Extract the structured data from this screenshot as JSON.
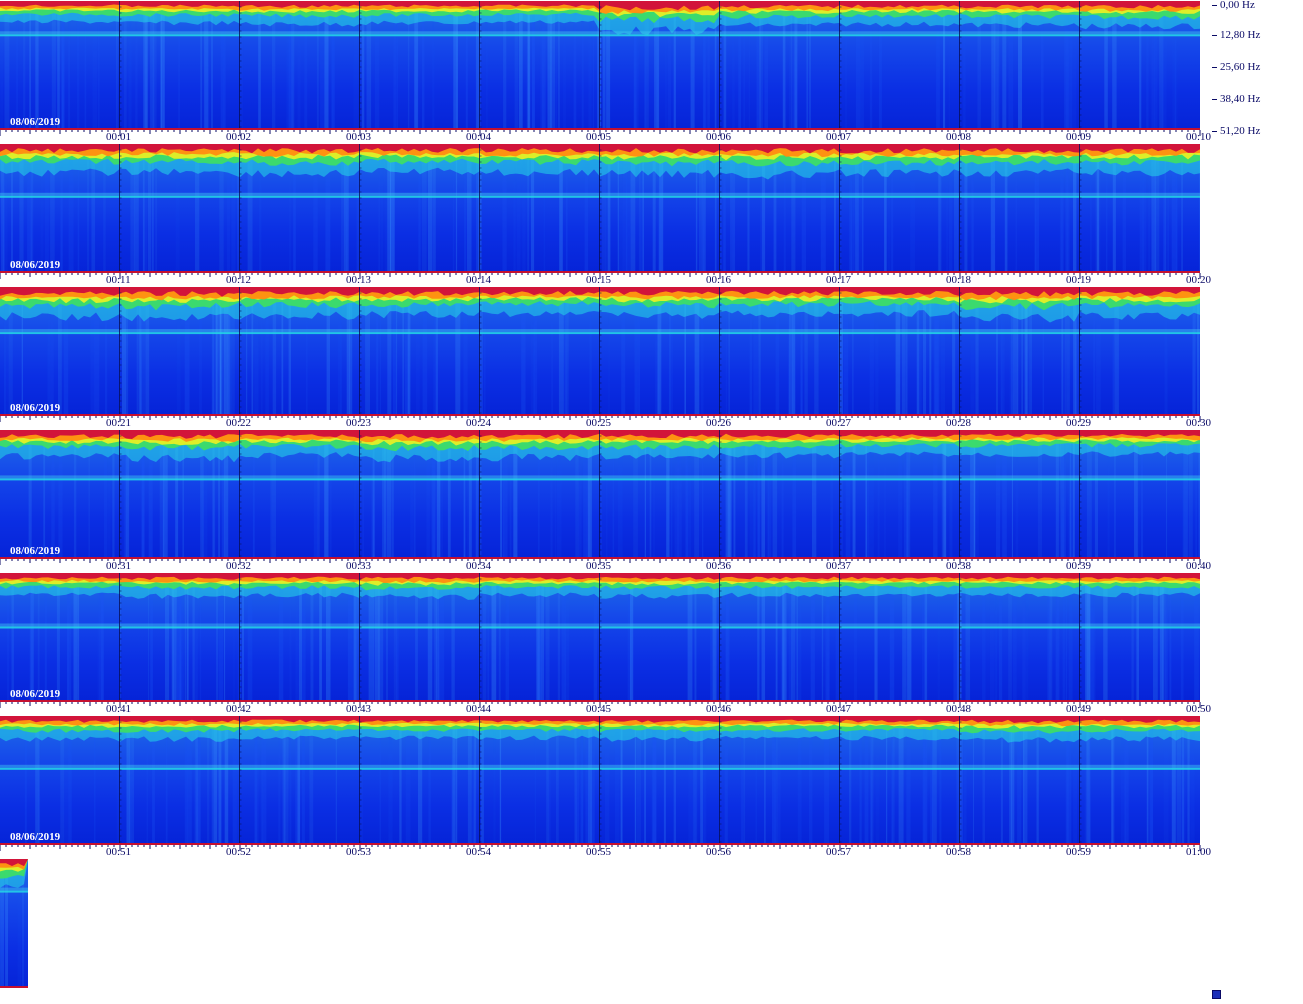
{
  "chart_data": {
    "type": "heatmap",
    "description_note": "",
    "date": "08/06/2019",
    "frequency_axis": {
      "labels": [
        "0,00 Hz",
        "12,80 Hz",
        "25,60 Hz",
        "38,40 Hz",
        "51,20 Hz"
      ],
      "range_hz": [
        0,
        51.2
      ]
    },
    "colormap": [
      "#0a1fe0",
      "#1f8ef0",
      "#25d9e6",
      "#3ee060",
      "#e6ef25",
      "#ff8c10",
      "#d2143a"
    ],
    "rows": [
      {
        "date": "08/06/2019",
        "time_labels": [
          "00:01",
          "00:02",
          "00:03",
          "00:04",
          "00:05",
          "00:06",
          "00:07",
          "00:08",
          "00:09",
          "00:10"
        ],
        "band_hz": 7.5,
        "activity": [
          0.35,
          0.4,
          0.45,
          0.4,
          0.35,
          0.75,
          0.5,
          0.45,
          0.5,
          0.55
        ]
      },
      {
        "date": "08/06/2019",
        "time_labels": [
          "00:11",
          "00:12",
          "00:13",
          "00:14",
          "00:15",
          "00:16",
          "00:17",
          "00:18",
          "00:19",
          "00:20"
        ],
        "band_hz": 13.0,
        "activity": [
          0.7,
          0.65,
          0.75,
          0.65,
          0.7,
          0.75,
          0.8,
          0.75,
          0.7,
          0.7
        ]
      },
      {
        "date": "08/06/2019",
        "time_labels": [
          "00:21",
          "00:22",
          "00:23",
          "00:24",
          "00:25",
          "00:26",
          "00:27",
          "00:28",
          "00:29",
          "00:30"
        ],
        "band_hz": 11.0,
        "activity": [
          0.75,
          0.8,
          0.7,
          0.65,
          0.6,
          0.7,
          0.65,
          0.6,
          0.8,
          0.7
        ]
      },
      {
        "date": "08/06/2019",
        "time_labels": [
          "00:31",
          "00:32",
          "00:33",
          "00:34",
          "00:35",
          "00:36",
          "00:37",
          "00:38",
          "00:39",
          "00:40"
        ],
        "band_hz": 12.0,
        "activity": [
          0.6,
          0.7,
          0.55,
          0.7,
          0.65,
          0.6,
          0.55,
          0.5,
          0.5,
          0.5
        ]
      },
      {
        "date": "08/06/2019",
        "time_labels": [
          "00:41",
          "00:42",
          "00:43",
          "00:44",
          "00:45",
          "00:46",
          "00:47",
          "00:48",
          "00:49",
          "00:50"
        ],
        "band_hz": 13.5,
        "activity": [
          0.4,
          0.45,
          0.4,
          0.5,
          0.4,
          0.45,
          0.4,
          0.4,
          0.4,
          0.4
        ]
      },
      {
        "date": "08/06/2019",
        "time_labels": [
          "00:51",
          "00:52",
          "00:53",
          "00:54",
          "00:55",
          "00:56",
          "00:57",
          "00:58",
          "00:59",
          "01:00"
        ],
        "band_hz": 13.0,
        "activity": [
          0.45,
          0.45,
          0.4,
          0.4,
          0.4,
          0.45,
          0.4,
          0.4,
          0.5,
          0.45
        ]
      }
    ],
    "partial_row": {
      "minutes": 0.23
    }
  },
  "icons": {
    "corner_marker": "scroll-marker-icon"
  }
}
